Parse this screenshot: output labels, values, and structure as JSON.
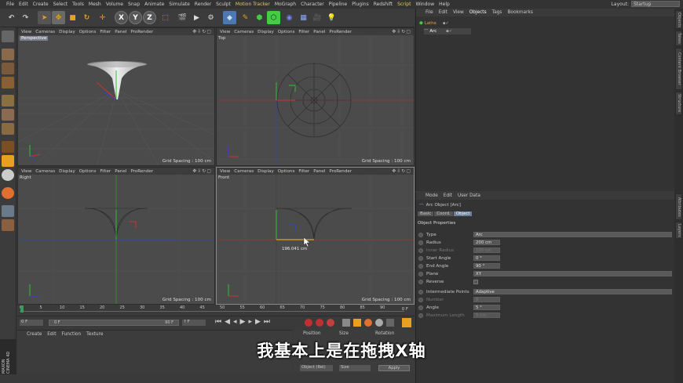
{
  "menu": {
    "items": [
      "File",
      "Edit",
      "Create",
      "Select",
      "Tools",
      "Mesh",
      "Volume",
      "Snap",
      "Animate",
      "Simulate",
      "Render",
      "Sculpt",
      "Motion Tracker",
      "MoGraph",
      "Character",
      "Pipeline",
      "Plugins",
      "Redshift",
      "Script",
      "Window",
      "Help"
    ],
    "layout_label": "Layout:",
    "layout_value": "Startup"
  },
  "toolbar": {
    "icons": [
      "undo-icon",
      "redo-icon",
      "select-icon",
      "move-icon",
      "scale-icon",
      "rotate-icon",
      "move-tool-icon",
      "x-axis-icon",
      "y-axis-icon",
      "z-axis-icon",
      "coordinate-system-icon",
      "render-view-icon",
      "render-picture-icon",
      "render-settings-icon",
      "cube-icon",
      "pen-icon",
      "subdivision-icon",
      "array-icon",
      "deformer-icon",
      "floor-icon",
      "camera-icon",
      "light-icon"
    ],
    "axis_labels": [
      "X",
      "Y",
      "Z"
    ]
  },
  "viewports": {
    "menu": [
      "View",
      "Cameras",
      "Display",
      "Options",
      "Filter",
      "Panel",
      "ProRender"
    ],
    "perspective": {
      "name": "Perspective",
      "grid": "Grid Spacing : 100 cm"
    },
    "top": {
      "name": "Top",
      "grid": "Grid Spacing : 100 cm"
    },
    "right": {
      "name": "Right",
      "grid": "Grid Spacing : 100 cm"
    },
    "front": {
      "name": "Front",
      "grid": "Grid Spacing : 100 cm",
      "drag_readout": "196.041 cm"
    }
  },
  "timeline": {
    "ticks": [
      "0",
      "5",
      "10",
      "15",
      "20",
      "25",
      "30",
      "35",
      "40",
      "45",
      "50",
      "55",
      "60",
      "65",
      "70",
      "75",
      "80",
      "85",
      "90"
    ],
    "end_frame": "0 F",
    "start_field": "0 F",
    "range_start": "0 F",
    "range_end": "90 F",
    "current_field": "? F"
  },
  "material_panel": {
    "menu": [
      "Create",
      "Edit",
      "Function",
      "Texture"
    ]
  },
  "coord_panel": {
    "headers": [
      "Position",
      "Size",
      "Rotation"
    ],
    "mode_select": "Object (Rel)",
    "size_select": "Size",
    "apply_label": "Apply"
  },
  "object_manager": {
    "menu": [
      "File",
      "Edit",
      "View",
      "Objects",
      "Tags",
      "Bookmarks"
    ],
    "objects": [
      {
        "name": "Lathe",
        "color": "#e0a040"
      },
      {
        "name": "Arc",
        "color": "#e0e0e0"
      }
    ]
  },
  "attribute_manager": {
    "menu": [
      "Mode",
      "Edit",
      "User Data"
    ],
    "object_title": "Arc Object [Arc]",
    "tabs": [
      "Basic",
      "Coord.",
      "Object"
    ],
    "active_tab": "Object",
    "section_title": "Object Properties",
    "props": [
      {
        "label": "Type",
        "value": "Arc",
        "kind": "dropdown"
      },
      {
        "label": "Radius",
        "value": "200 cm",
        "kind": "field"
      },
      {
        "label": "Inner Radius",
        "value": "100 cm",
        "kind": "field",
        "dim": true
      },
      {
        "label": "Start Angle",
        "value": "0 °",
        "kind": "field"
      },
      {
        "label": "End Angle",
        "value": "90 °",
        "kind": "field"
      },
      {
        "label": "Plane",
        "value": "XY",
        "kind": "dropdown"
      },
      {
        "label": "Reverse",
        "value": "",
        "kind": "check"
      },
      {
        "label": "Intermediate Points",
        "value": "Adaptive",
        "kind": "dropdown"
      },
      {
        "label": "Number",
        "value": "8",
        "kind": "field",
        "dim": true
      },
      {
        "label": "Angle",
        "value": "5 °",
        "kind": "field"
      },
      {
        "label": "Maximum Length",
        "value": "5 cm",
        "kind": "field",
        "dim": true
      }
    ]
  },
  "right_tabs": [
    "Objects",
    "Takes",
    "Content Browser",
    "Structure",
    "Attributes",
    "Layers"
  ],
  "branding": {
    "line1": "MAXON",
    "line2": "CINEMA 4D"
  },
  "subtitle": "我基本上是在拖拽X轴",
  "colors": {
    "x_axis": "#d03030",
    "y_axis": "#30c030",
    "z_axis": "#3040d0",
    "highlight": "#e8a020"
  }
}
